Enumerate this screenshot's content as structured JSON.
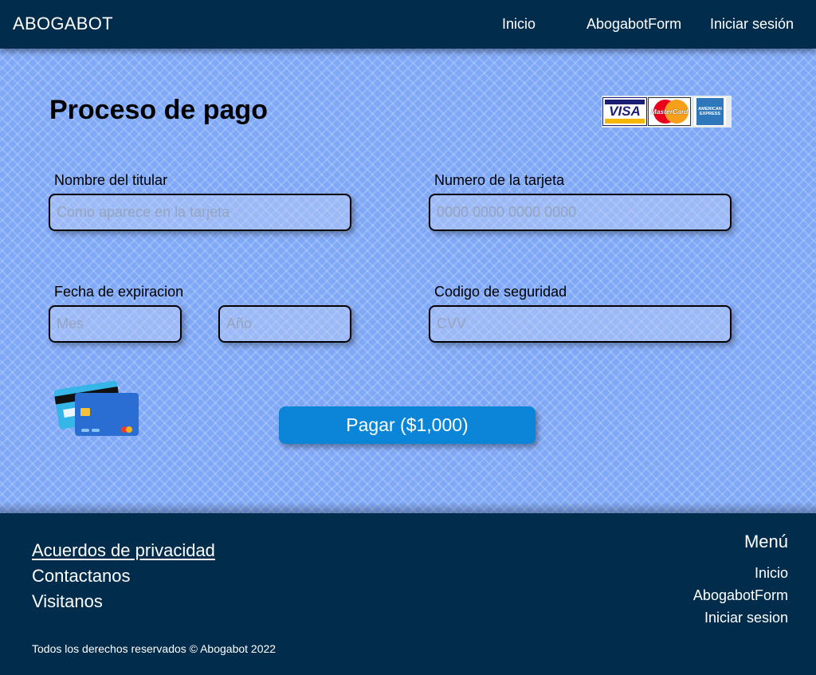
{
  "navbar": {
    "brand": "ABOGABOT",
    "links": [
      "Inicio",
      "AbogabotForm",
      "Iniciar sesión"
    ]
  },
  "payment": {
    "title": "Proceso de pago",
    "card_logos": [
      "VISA",
      "MasterCard",
      "AMERICAN EXPRESS"
    ],
    "holder": {
      "label": "Nombre del titular",
      "placeholder": "Como aparece en la tarjeta",
      "value": ""
    },
    "card_number": {
      "label": "Numero de la tarjeta",
      "placeholder": "0000 0000 0000 0000",
      "value": ""
    },
    "expiration": {
      "label": "Fecha de expiracion",
      "month_placeholder": "Mes",
      "year_placeholder": "Año"
    },
    "security_code": {
      "label": "Codigo de seguridad",
      "placeholder": "CVV",
      "value": ""
    },
    "pay_button": "Pagar ($1,000)",
    "colors": {
      "background": "#7fa8f6",
      "button": "#0a85d8",
      "navbar": "#022c4b"
    }
  },
  "footer": {
    "links": [
      "Acuerdos de privacidad",
      "Contactanos",
      "Visitanos"
    ],
    "menu_heading": "Menú",
    "menu_links": [
      "Inicio",
      "AbogabotForm",
      "Iniciar sesion"
    ],
    "copyright": "Todos los derechos reservados © Abogabot 2022"
  }
}
